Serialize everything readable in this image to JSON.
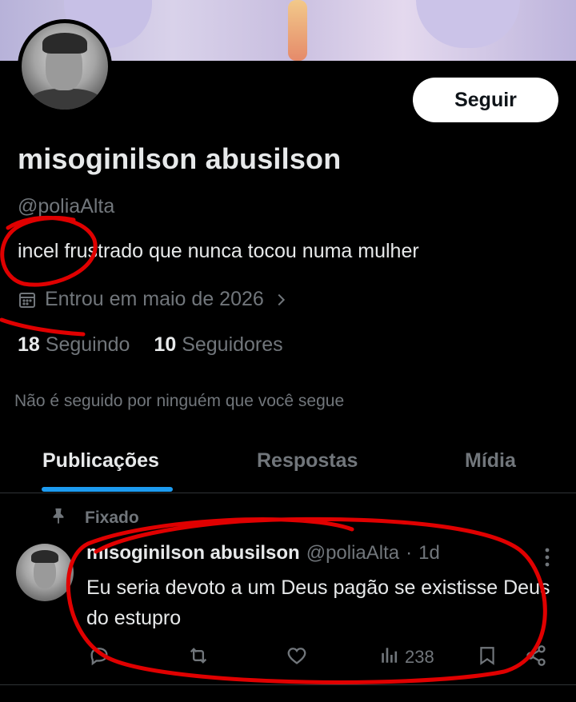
{
  "profile": {
    "display_name": "misoginilson abusilson",
    "handle": "@poliaAlta",
    "bio": "incel frustrado que nunca tocou numa mulher",
    "joined": "Entrou em maio de 2026",
    "following_count": "18",
    "following_label": "Seguindo",
    "followers_count": "10",
    "followers_label": "Seguidores",
    "not_followed_note": "Não é seguido por ninguém que você segue",
    "follow_button": "Seguir"
  },
  "tabs": [
    {
      "label": "Publicações",
      "active": true
    },
    {
      "label": "Respostas",
      "active": false
    },
    {
      "label": "Mídia",
      "active": false
    }
  ],
  "post": {
    "pinned_label": "Fixado",
    "author_name": "misoginilson abusilson",
    "author_handle": "@poliaAlta",
    "separator": "·",
    "time": "1d",
    "text": "Eu seria devoto a um Deus pagão se existisse Deus do estupro",
    "views": "238"
  },
  "colors": {
    "background": "#000000",
    "text_primary": "#e7e9ea",
    "text_secondary": "#71767b",
    "accent": "#1d9bf0",
    "annotation_red": "#e00000"
  },
  "icons": [
    "calendar-icon",
    "chevron-right-icon",
    "pin-icon",
    "more-icon",
    "reply-icon",
    "repost-icon",
    "like-icon",
    "views-icon",
    "bookmark-icon",
    "share-icon"
  ]
}
